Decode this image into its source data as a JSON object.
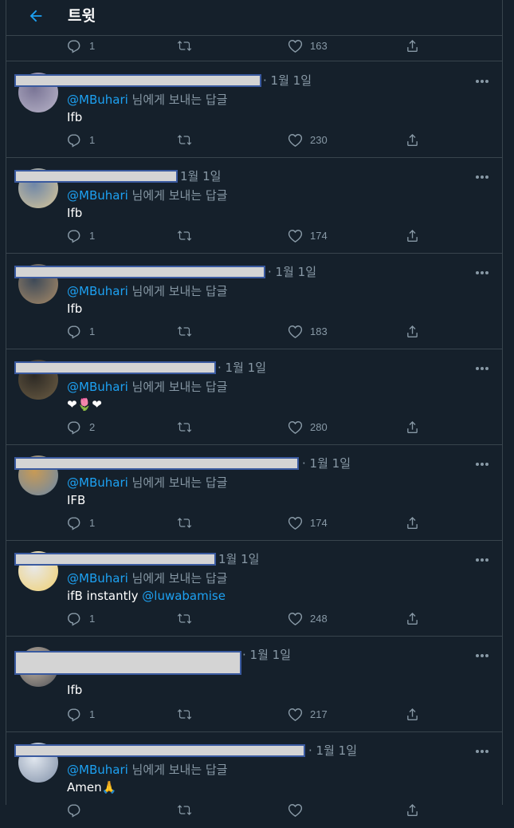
{
  "header": {
    "title": "트윗",
    "back_icon": "arrow-left-icon"
  },
  "colors": {
    "accent": "#1da1f2",
    "background": "#15202b",
    "muted": "#8899a6",
    "border": "#38444d"
  },
  "top_actions": {
    "replies": "1",
    "likes": "163"
  },
  "tweets": [
    {
      "date": "· 1월 1일",
      "reply_to": "@MBuhari",
      "reply_suffix": " 님에게 보내는 답글",
      "text": "Ifb",
      "mention": "",
      "replies": "1",
      "likes": "230"
    },
    {
      "date": "1월 1일",
      "reply_to": "@MBuhari",
      "reply_suffix": " 님에게 보내는 답글",
      "text": "Ifb",
      "mention": "",
      "replies": "1",
      "likes": "174"
    },
    {
      "date": "· 1월 1일",
      "reply_to": "@MBuhari",
      "reply_suffix": " 님에게 보내는 답글",
      "text": "Ifb",
      "mention": "",
      "replies": "1",
      "likes": "183"
    },
    {
      "date": "· 1월 1일",
      "reply_to": "@MBuhari",
      "reply_suffix": " 님에게 보내는 답글",
      "text": "❤🌷❤",
      "mention": "",
      "replies": "2",
      "likes": "280"
    },
    {
      "date": "· 1월 1일",
      "reply_to": "@MBuhari",
      "reply_suffix": " 님에게 보내는 답글",
      "text": "IFB",
      "mention": "",
      "replies": "1",
      "likes": "174"
    },
    {
      "date": "1월 1일",
      "reply_to": "@MBuhari",
      "reply_suffix": " 님에게 보내는 답글",
      "text": "ifB instantly ",
      "mention": "@luwabamise",
      "replies": "1",
      "likes": "248"
    },
    {
      "date": "· 1월 1일",
      "reply_to": "",
      "reply_suffix": "",
      "text": "Ifb",
      "mention": "",
      "replies": "1",
      "likes": "217"
    },
    {
      "date": "· 1월 1일",
      "reply_to": "@MBuhari",
      "reply_suffix": " 님에게 보내는 답글",
      "text": "Amen🙏",
      "mention": "",
      "replies": "",
      "likes": ""
    }
  ]
}
